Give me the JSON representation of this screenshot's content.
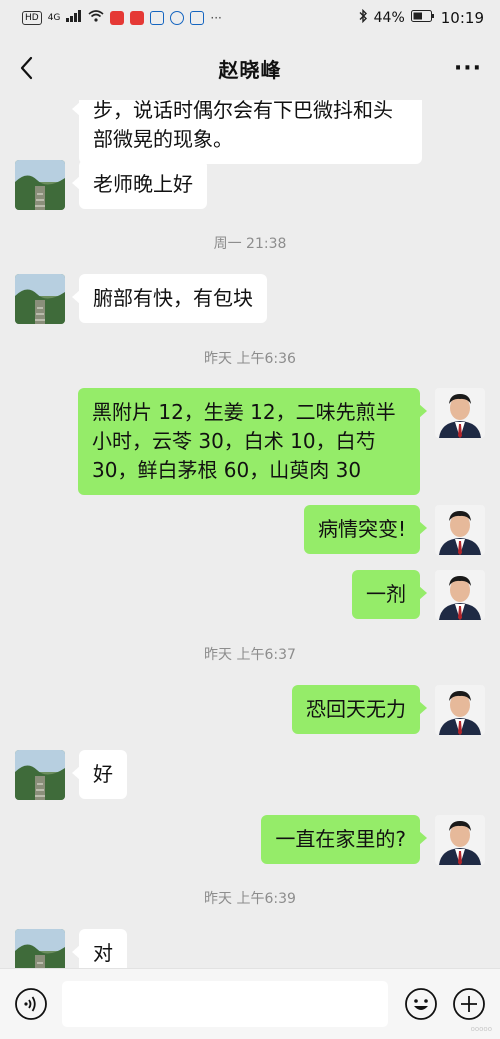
{
  "status_bar": {
    "left_indicators": [
      "HD",
      "4G"
    ],
    "battery": "44%",
    "time": "10:19"
  },
  "nav": {
    "title": "赵晓峰",
    "more": "···"
  },
  "messages": [
    {
      "side": "left",
      "text": "步，说话时偶尔会有下巴微抖和头部微晃的现象。"
    },
    {
      "side": "left",
      "text": "老师晚上好"
    },
    {
      "type": "time",
      "text": "周一 21:38"
    },
    {
      "side": "left",
      "text": "腑部有快，有包块"
    },
    {
      "type": "time",
      "text": "昨天 上午6:36"
    },
    {
      "side": "right",
      "text": "黑附片 12，生姜 12，二味先煎半小时，云苓 30，白术 10，白芍 30，鲜白茅根 60，山萸肉 30"
    },
    {
      "side": "right",
      "text": "病情突变!"
    },
    {
      "side": "right",
      "text": "一剂"
    },
    {
      "type": "time",
      "text": "昨天 上午6:37"
    },
    {
      "side": "right",
      "text": "恐回天无力"
    },
    {
      "side": "left",
      "text": "好"
    },
    {
      "side": "right",
      "text": "一直在家里的?"
    },
    {
      "type": "time",
      "text": "昨天 上午6:39"
    },
    {
      "side": "left",
      "text": "对"
    }
  ],
  "input": {
    "value": "",
    "placeholder": ""
  },
  "watermark": "ooooo",
  "colors": {
    "background": "#ededed",
    "bubble_self": "#95ec69",
    "bubble_other": "#ffffff",
    "timestamp": "#8d8d8d"
  },
  "icons": {
    "back": "chevron-left-icon",
    "more": "more-dots-icon",
    "voice": "voice-icon",
    "emoji": "emoji-icon",
    "plus": "plus-icon"
  }
}
